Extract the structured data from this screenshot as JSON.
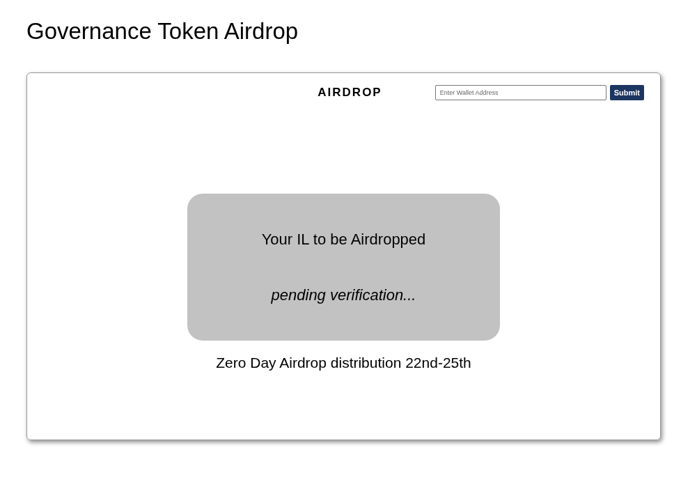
{
  "page_title": "Governance Token Airdrop",
  "card": {
    "brand": "AIRDROP",
    "wallet_field": {
      "placeholder": "Enter Wallet Address"
    },
    "submit_button": "Submit",
    "status_panel": {
      "heading": "Your IL to be Airdropped",
      "status": "pending verification..."
    },
    "caption": "Zero Day Airdrop distribution 22nd-25th"
  }
}
